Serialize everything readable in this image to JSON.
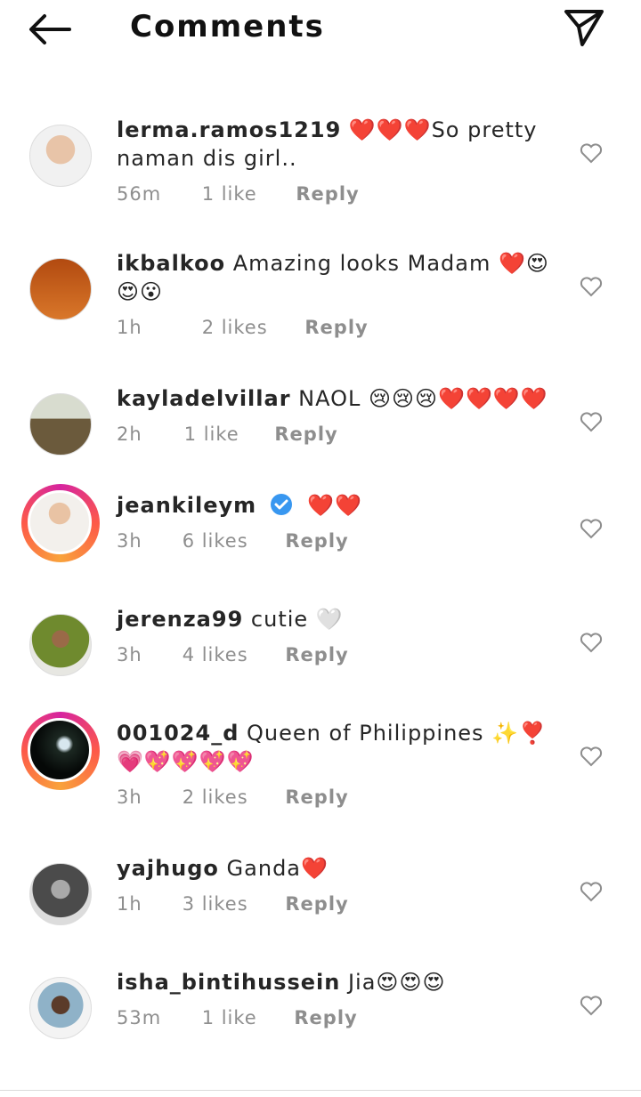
{
  "header": {
    "title": "Comments",
    "back_icon": "arrow-left-icon",
    "send_icon": "paper-plane-icon"
  },
  "comments": [
    {
      "username": "lerma.ramos1219",
      "text": "❤️❤️❤️So pretty naman dis girl..",
      "time": "56m",
      "likes": "1 like",
      "reply": "Reply"
    },
    {
      "username": "ikbalkoo",
      "text": "Amazing looks Madam ❤️😍😍😮",
      "time": "1h",
      "likes": "2 likes",
      "reply": "Reply"
    },
    {
      "username": "kayladelvillar",
      "text": "NAOL 😢😢😢❤️❤️❤️❤️",
      "time": "2h",
      "likes": "1 like",
      "reply": "Reply"
    },
    {
      "username": "jeankileym",
      "text": "❤️❤️",
      "time": "3h",
      "likes": "6 likes",
      "reply": "Reply",
      "verified": true
    },
    {
      "username": "jerenza99",
      "text": "cutie 🤍",
      "time": "3h",
      "likes": "4 likes",
      "reply": "Reply"
    },
    {
      "username": "001024_d",
      "text": "Queen of Philippines ✨❣️💗💖💖💖💖",
      "time": "3h",
      "likes": "2 likes",
      "reply": "Reply"
    },
    {
      "username": "yajhugo",
      "text": "Ganda❤️",
      "time": "1h",
      "likes": "3 likes",
      "reply": "Reply"
    },
    {
      "username": "isha_bintihussein",
      "text": "Jia😍😍😍",
      "time": "53m",
      "likes": "1 like",
      "reply": "Reply"
    }
  ]
}
